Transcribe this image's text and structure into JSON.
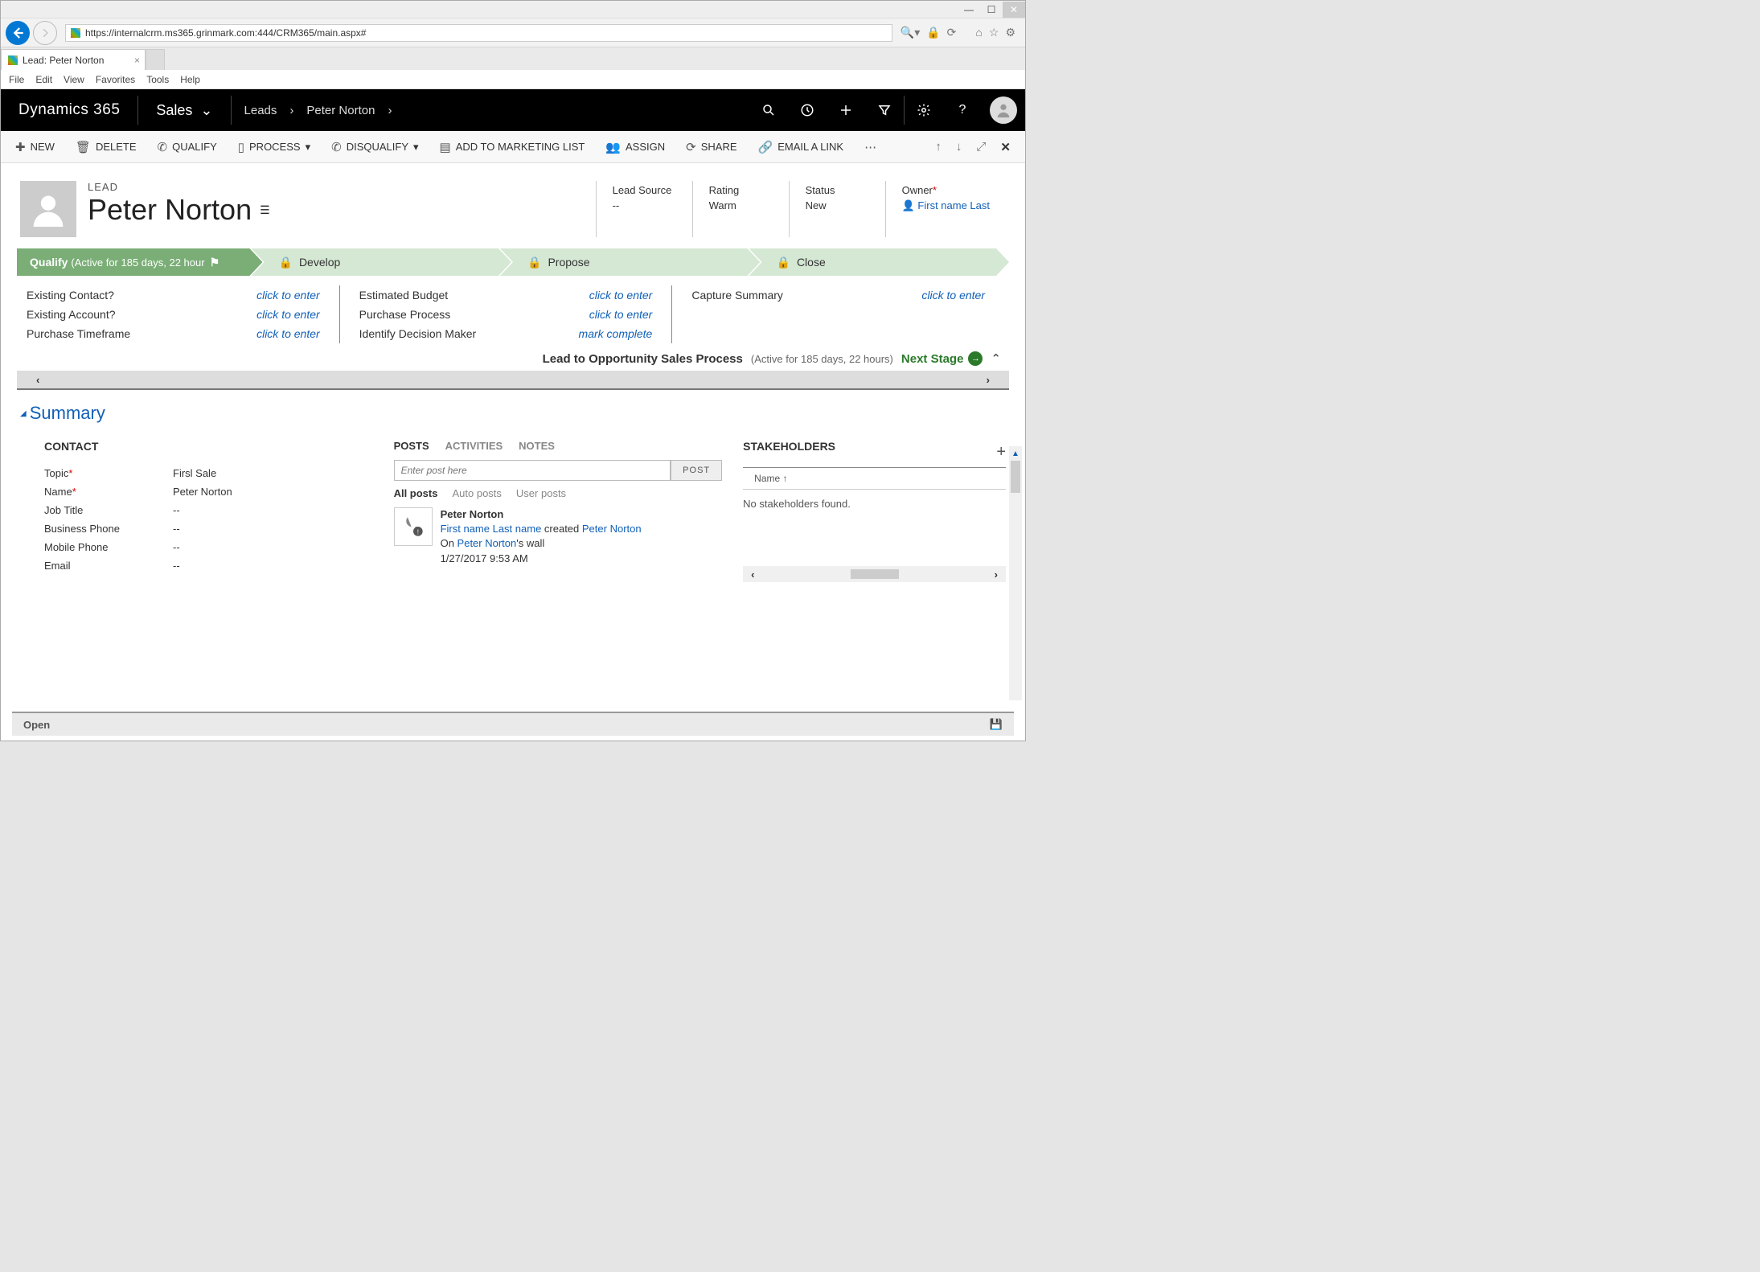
{
  "browser": {
    "url": "https://internalcrm.ms365.grinmark.com:444/CRM365/main.aspx#",
    "tab_title": "Lead: Peter Norton",
    "menus": [
      "File",
      "Edit",
      "View",
      "Favorites",
      "Tools",
      "Help"
    ]
  },
  "topnav": {
    "brand": "Dynamics 365",
    "area": "Sales",
    "crumbs": [
      "Leads",
      "Peter Norton"
    ]
  },
  "commands": {
    "new": "NEW",
    "delete": "DELETE",
    "qualify": "QUALIFY",
    "process": "PROCESS",
    "disqualify": "DISQUALIFY",
    "add_marketing": "ADD TO MARKETING LIST",
    "assign": "ASSIGN",
    "share": "SHARE",
    "email_link": "EMAIL A LINK"
  },
  "header": {
    "type": "LEAD",
    "name": "Peter Norton",
    "fields": {
      "lead_source": {
        "label": "Lead Source",
        "value": "--"
      },
      "rating": {
        "label": "Rating",
        "value": "Warm"
      },
      "status": {
        "label": "Status",
        "value": "New"
      },
      "owner": {
        "label": "Owner",
        "value": "First name Last"
      }
    }
  },
  "process": {
    "stages": {
      "qualify": {
        "label": "Qualify",
        "sub": "(Active for 185 days, 22 hour"
      },
      "develop": "Develop",
      "propose": "Propose",
      "close": "Close"
    },
    "fields": {
      "col1": [
        {
          "label": "Existing Contact?",
          "value": "click to enter"
        },
        {
          "label": "Existing Account?",
          "value": "click to enter"
        },
        {
          "label": "Purchase Timeframe",
          "value": "click to enter"
        }
      ],
      "col2": [
        {
          "label": "Estimated Budget",
          "value": "click to enter"
        },
        {
          "label": "Purchase Process",
          "value": "click to enter"
        },
        {
          "label": "Identify Decision Maker",
          "value": "mark complete"
        }
      ],
      "col3": [
        {
          "label": "Capture Summary",
          "value": "click to enter"
        }
      ]
    },
    "footer": {
      "title": "Lead to Opportunity Sales Process",
      "sub": "(Active for 185 days, 22 hours)",
      "next": "Next Stage"
    }
  },
  "summary": {
    "title": "Summary",
    "contact": {
      "title": "CONTACT",
      "fields": [
        {
          "label": "Topic",
          "req": true,
          "value": "Firsl Sale"
        },
        {
          "label": "Name",
          "req": true,
          "value": "Peter Norton"
        },
        {
          "label": "Job Title",
          "value": "--"
        },
        {
          "label": "Business Phone",
          "value": "--"
        },
        {
          "label": "Mobile Phone",
          "value": "--"
        },
        {
          "label": "Email",
          "value": "--"
        }
      ]
    },
    "posts": {
      "tabs": [
        "POSTS",
        "ACTIVITIES",
        "NOTES"
      ],
      "placeholder": "Enter post here",
      "post_btn": "POST",
      "filters": [
        "All posts",
        "Auto posts",
        "User posts"
      ],
      "item": {
        "name": "Peter Norton",
        "actor": "First name Last name",
        "action": " created ",
        "target": "Peter Norton",
        "on": "On ",
        "wall_of": "Peter Norton",
        "wall_suffix": "'s wall",
        "date": "1/27/2017 9:53 AM"
      }
    },
    "stakeholders": {
      "title": "STAKEHOLDERS",
      "sort": "Name ↑",
      "empty": "No stakeholders found."
    }
  },
  "footer": {
    "status": "Open"
  }
}
